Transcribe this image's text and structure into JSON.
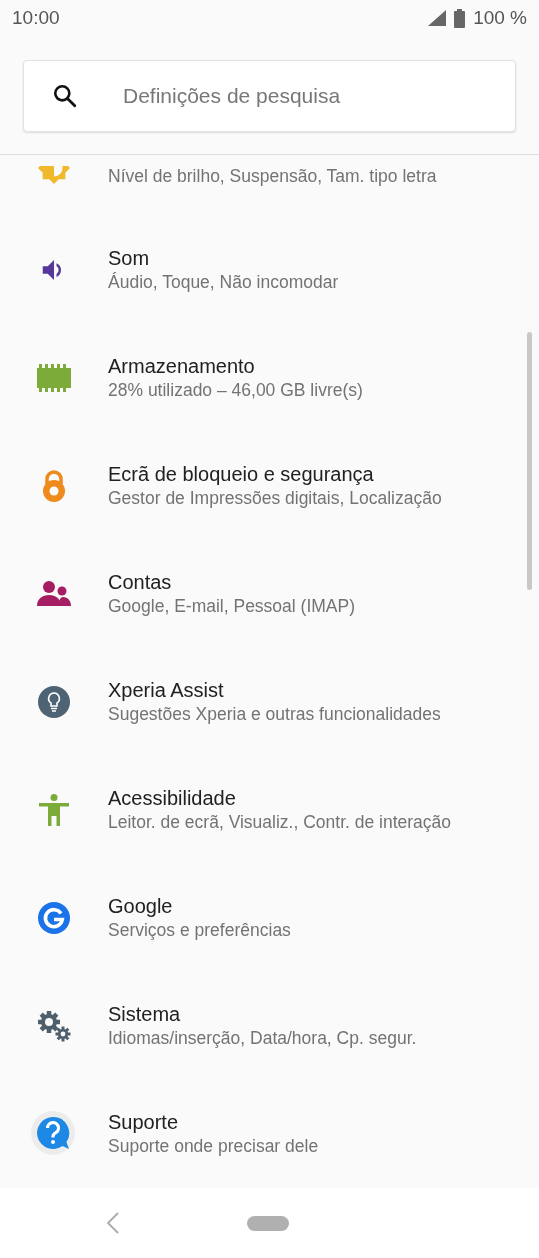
{
  "status_bar": {
    "time": "10:00",
    "battery": "100 %"
  },
  "search": {
    "placeholder": "Definições de pesquisa"
  },
  "items": [
    {
      "kind": "partial",
      "subtitle": "Nível de brilho, Suspensão, Tam. tipo letra"
    },
    {
      "kind": "full",
      "title": "Som",
      "subtitle": "Áudio, Toque, Não incomodar"
    },
    {
      "kind": "full",
      "title": "Armazenamento",
      "subtitle": "28% utilizado – 46,00 GB livre(s)"
    },
    {
      "kind": "full",
      "title": "Ecrã de bloqueio e segurança",
      "subtitle": "Gestor de Impressões digitais, Localização"
    },
    {
      "kind": "full",
      "title": "Contas",
      "subtitle": "Google, E-mail, Pessoal (IMAP)"
    },
    {
      "kind": "full",
      "title": "Xperia Assist",
      "subtitle": "Sugestões Xperia e outras funcionalidades"
    },
    {
      "kind": "full",
      "title": "Acessibilidade",
      "subtitle": "Leitor. de ecrã, Visualiz., Contr. de interação"
    },
    {
      "kind": "full",
      "title": "Google",
      "subtitle": "Serviços e preferências"
    },
    {
      "kind": "full",
      "title": "Sistema",
      "subtitle": "Idiomas/inserção, Data/hora, Cp. segur."
    },
    {
      "kind": "full",
      "title": "Suporte",
      "subtitle": "Suporte onde precisar dele"
    }
  ]
}
